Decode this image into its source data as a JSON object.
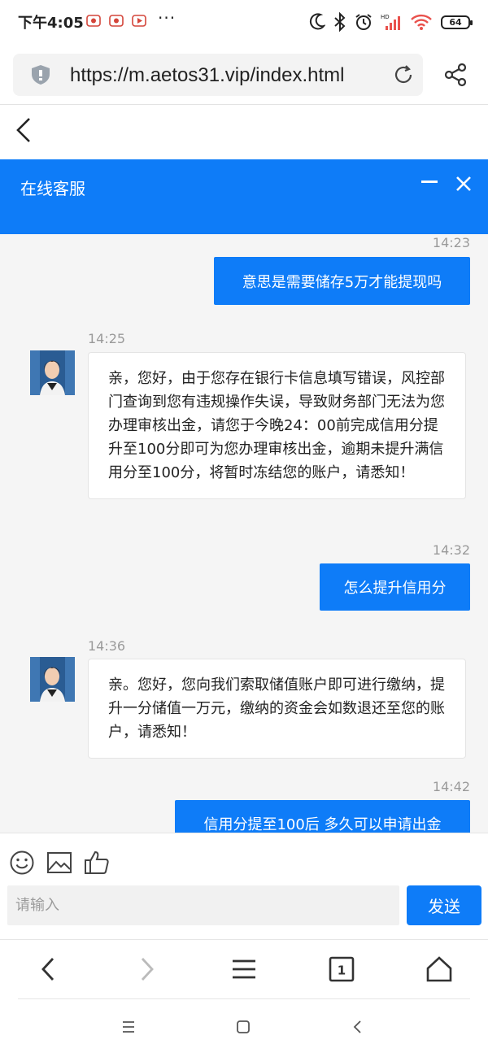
{
  "status_bar": {
    "time": "下午4:05",
    "dots": "···",
    "battery": "64",
    "signal_label": "HD"
  },
  "browser": {
    "url": "https://m.aetos31.vip/index.html"
  },
  "chat_header": {
    "title": "在线客服"
  },
  "messages": [
    {
      "direction": "out",
      "time": "14:23",
      "text": "意思是需要储存5万才能提现吗"
    },
    {
      "direction": "in",
      "time": "14:25",
      "text": "亲，您好，由于您存在银行卡信息填写错误，风控部门查询到您有违规操作失误，导致财务部门无法为您办理审核出金，请您于今晚24：00前完成信用分提升至100分即可为您办理审核出金，逾期未提升满信用分至100分，将暂时冻结您的账户，请悉知！"
    },
    {
      "direction": "out",
      "time": "14:32",
      "text": "怎么提升信用分"
    },
    {
      "direction": "in",
      "time": "14:36",
      "text": "亲。您好，您向我们索取储值账户即可进行缴纳，提升一分储值一万元，缴纳的资金会如数退还至您的账户，请悉知！"
    },
    {
      "direction": "out",
      "time": "14:42",
      "text": "信用分提至100后 多久可以申请出金"
    }
  ],
  "composer": {
    "placeholder": "请输入",
    "send_label": "发送"
  },
  "browser_nav": {
    "tab_count": "1"
  },
  "colors": {
    "accent": "#0e7cf8",
    "chat_bg": "#f5f5f5",
    "timestamp": "#9a9a9a"
  },
  "icons": [
    "dnd-moon-icon",
    "bluetooth-icon",
    "alarm-icon",
    "signal-icon",
    "wifi-icon",
    "battery-icon",
    "shield-icon",
    "reload-icon",
    "share-icon",
    "back-icon",
    "minimize-icon",
    "close-icon",
    "emoji-icon",
    "image-icon",
    "thumbs-up-icon",
    "menu-icon",
    "home-icon"
  ]
}
